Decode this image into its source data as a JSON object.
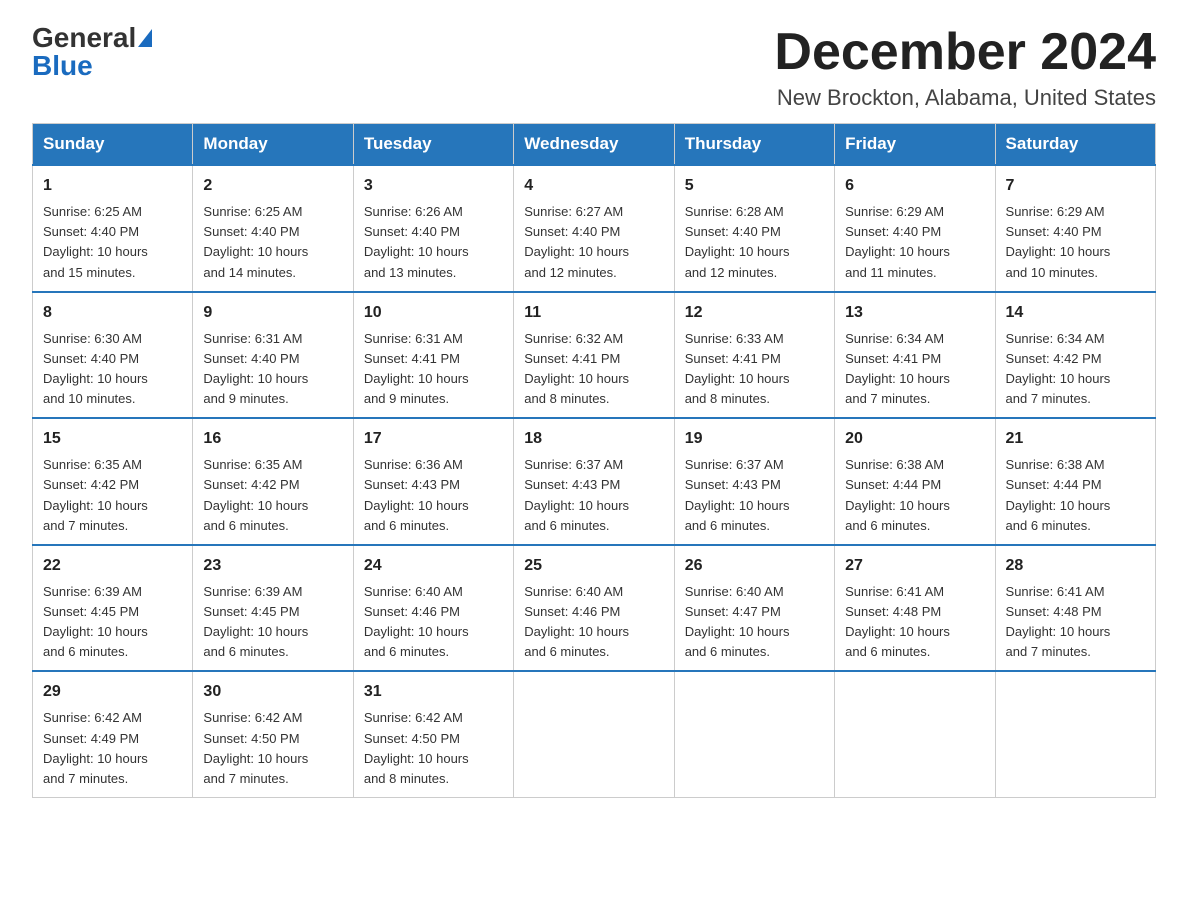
{
  "logo": {
    "general": "General",
    "blue": "Blue"
  },
  "header": {
    "month": "December 2024",
    "location": "New Brockton, Alabama, United States"
  },
  "weekdays": [
    "Sunday",
    "Monday",
    "Tuesday",
    "Wednesday",
    "Thursday",
    "Friday",
    "Saturday"
  ],
  "weeks": [
    [
      {
        "day": "1",
        "sunrise": "6:25 AM",
        "sunset": "4:40 PM",
        "daylight": "10 hours and 15 minutes."
      },
      {
        "day": "2",
        "sunrise": "6:25 AM",
        "sunset": "4:40 PM",
        "daylight": "10 hours and 14 minutes."
      },
      {
        "day": "3",
        "sunrise": "6:26 AM",
        "sunset": "4:40 PM",
        "daylight": "10 hours and 13 minutes."
      },
      {
        "day": "4",
        "sunrise": "6:27 AM",
        "sunset": "4:40 PM",
        "daylight": "10 hours and 12 minutes."
      },
      {
        "day": "5",
        "sunrise": "6:28 AM",
        "sunset": "4:40 PM",
        "daylight": "10 hours and 12 minutes."
      },
      {
        "day": "6",
        "sunrise": "6:29 AM",
        "sunset": "4:40 PM",
        "daylight": "10 hours and 11 minutes."
      },
      {
        "day": "7",
        "sunrise": "6:29 AM",
        "sunset": "4:40 PM",
        "daylight": "10 hours and 10 minutes."
      }
    ],
    [
      {
        "day": "8",
        "sunrise": "6:30 AM",
        "sunset": "4:40 PM",
        "daylight": "10 hours and 10 minutes."
      },
      {
        "day": "9",
        "sunrise": "6:31 AM",
        "sunset": "4:40 PM",
        "daylight": "10 hours and 9 minutes."
      },
      {
        "day": "10",
        "sunrise": "6:31 AM",
        "sunset": "4:41 PM",
        "daylight": "10 hours and 9 minutes."
      },
      {
        "day": "11",
        "sunrise": "6:32 AM",
        "sunset": "4:41 PM",
        "daylight": "10 hours and 8 minutes."
      },
      {
        "day": "12",
        "sunrise": "6:33 AM",
        "sunset": "4:41 PM",
        "daylight": "10 hours and 8 minutes."
      },
      {
        "day": "13",
        "sunrise": "6:34 AM",
        "sunset": "4:41 PM",
        "daylight": "10 hours and 7 minutes."
      },
      {
        "day": "14",
        "sunrise": "6:34 AM",
        "sunset": "4:42 PM",
        "daylight": "10 hours and 7 minutes."
      }
    ],
    [
      {
        "day": "15",
        "sunrise": "6:35 AM",
        "sunset": "4:42 PM",
        "daylight": "10 hours and 7 minutes."
      },
      {
        "day": "16",
        "sunrise": "6:35 AM",
        "sunset": "4:42 PM",
        "daylight": "10 hours and 6 minutes."
      },
      {
        "day": "17",
        "sunrise": "6:36 AM",
        "sunset": "4:43 PM",
        "daylight": "10 hours and 6 minutes."
      },
      {
        "day": "18",
        "sunrise": "6:37 AM",
        "sunset": "4:43 PM",
        "daylight": "10 hours and 6 minutes."
      },
      {
        "day": "19",
        "sunrise": "6:37 AM",
        "sunset": "4:43 PM",
        "daylight": "10 hours and 6 minutes."
      },
      {
        "day": "20",
        "sunrise": "6:38 AM",
        "sunset": "4:44 PM",
        "daylight": "10 hours and 6 minutes."
      },
      {
        "day": "21",
        "sunrise": "6:38 AM",
        "sunset": "4:44 PM",
        "daylight": "10 hours and 6 minutes."
      }
    ],
    [
      {
        "day": "22",
        "sunrise": "6:39 AM",
        "sunset": "4:45 PM",
        "daylight": "10 hours and 6 minutes."
      },
      {
        "day": "23",
        "sunrise": "6:39 AM",
        "sunset": "4:45 PM",
        "daylight": "10 hours and 6 minutes."
      },
      {
        "day": "24",
        "sunrise": "6:40 AM",
        "sunset": "4:46 PM",
        "daylight": "10 hours and 6 minutes."
      },
      {
        "day": "25",
        "sunrise": "6:40 AM",
        "sunset": "4:46 PM",
        "daylight": "10 hours and 6 minutes."
      },
      {
        "day": "26",
        "sunrise": "6:40 AM",
        "sunset": "4:47 PM",
        "daylight": "10 hours and 6 minutes."
      },
      {
        "day": "27",
        "sunrise": "6:41 AM",
        "sunset": "4:48 PM",
        "daylight": "10 hours and 6 minutes."
      },
      {
        "day": "28",
        "sunrise": "6:41 AM",
        "sunset": "4:48 PM",
        "daylight": "10 hours and 7 minutes."
      }
    ],
    [
      {
        "day": "29",
        "sunrise": "6:42 AM",
        "sunset": "4:49 PM",
        "daylight": "10 hours and 7 minutes."
      },
      {
        "day": "30",
        "sunrise": "6:42 AM",
        "sunset": "4:50 PM",
        "daylight": "10 hours and 7 minutes."
      },
      {
        "day": "31",
        "sunrise": "6:42 AM",
        "sunset": "4:50 PM",
        "daylight": "10 hours and 8 minutes."
      },
      null,
      null,
      null,
      null
    ]
  ],
  "labels": {
    "sunrise": "Sunrise:",
    "sunset": "Sunset:",
    "daylight": "Daylight:"
  }
}
